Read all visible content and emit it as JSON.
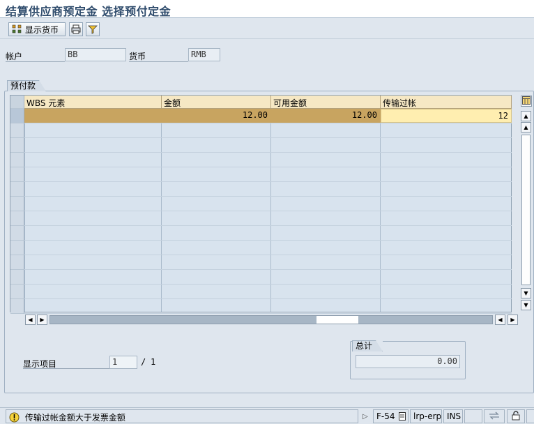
{
  "window": {
    "title": "结算供应商预定金 选择预付定金"
  },
  "toolbar": {
    "show_currency_label": "显示货币"
  },
  "header_fields": {
    "account_label": "帐户",
    "account_value": "BB",
    "currency_label": "货币",
    "currency_value": "RMB"
  },
  "prepayment_group": {
    "title": "预付款",
    "columns": [
      "WBS 元素",
      "金额",
      "可用金额",
      "传输过帐"
    ],
    "rows": [
      {
        "wbs": "",
        "amount": "12.00",
        "available": "12.00",
        "transfer": "12"
      }
    ],
    "empty_row_count": 13
  },
  "footer": {
    "display_items_label": "显示项目",
    "current_item": "1",
    "total_items": "1",
    "separator": "/",
    "total_group_title": "总计",
    "total_value": "0.00"
  },
  "status_bar": {
    "message": "传输过帐金额大于发票金额",
    "transaction": "F-54",
    "server": "lrp-erp",
    "mode": "INS"
  },
  "colors": {
    "header_bg": "#f6e8c4",
    "selected_row": "#c8a460",
    "input_cell": "#ffeeb0",
    "grid_bg": "#d8e3ee"
  }
}
